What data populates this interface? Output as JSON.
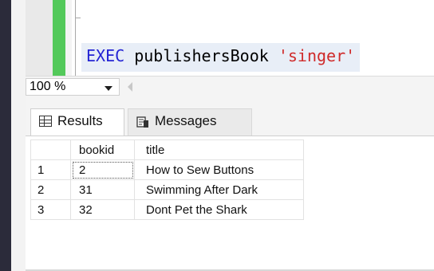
{
  "editor": {
    "keyword": "EXEC",
    "procedure": "publishersBook",
    "argument": "'singer'"
  },
  "zoom": {
    "value": "100 %"
  },
  "tabs": [
    {
      "label": "Results",
      "icon": "grid-icon"
    },
    {
      "label": "Messages",
      "icon": "messages-icon"
    }
  ],
  "results": {
    "columns": [
      "bookid",
      "title"
    ],
    "rows": [
      {
        "num": "1",
        "bookid": "2",
        "title": "How to Sew Buttons"
      },
      {
        "num": "2",
        "bookid": "31",
        "title": "Swimming After Dark"
      },
      {
        "num": "3",
        "bookid": "32",
        "title": "Dont Pet the Shark"
      }
    ]
  },
  "colors": {
    "keyword": "#2424d4",
    "string": "#cf2a2a",
    "change_bar": "#53c95a"
  }
}
